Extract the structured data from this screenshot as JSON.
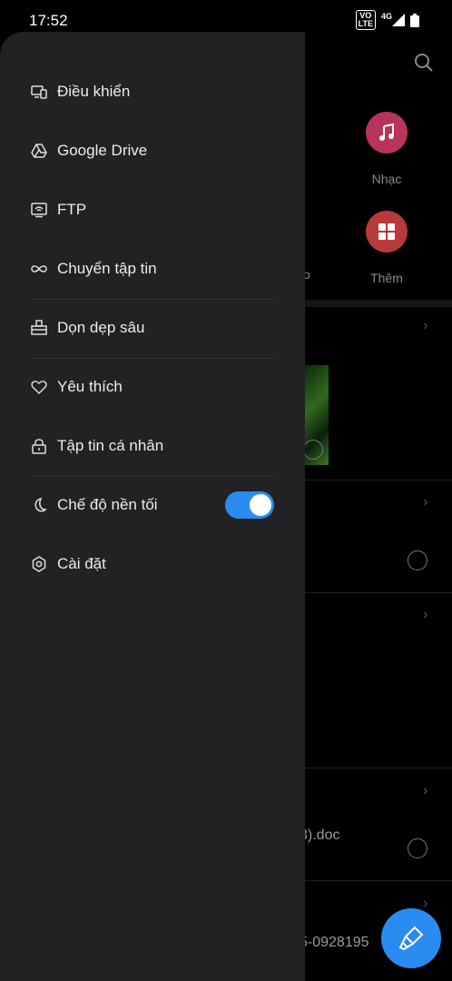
{
  "status_bar": {
    "time": "17:52",
    "volte_top": "VO",
    "volte_bottom": "LTE",
    "network": "4G"
  },
  "background": {
    "categories": [
      {
        "label": "Nhạc",
        "color": "#b8345d",
        "icon": "music-note-icon"
      },
      {
        "label": "Thêm",
        "color": "#b83a3a",
        "icon": "grid-icon"
      }
    ],
    "partial_label": "o",
    "file_name_1": "3).doc",
    "file_name_2": "5-0928195"
  },
  "drawer": {
    "items": [
      {
        "label": "Điều khiển",
        "icon": "remote-devices-icon"
      },
      {
        "label": "Google Drive",
        "icon": "google-drive-icon"
      },
      {
        "label": "FTP",
        "icon": "ftp-icon"
      },
      {
        "label": "Chuyển tập tin",
        "icon": "infinity-transfer-icon"
      },
      {
        "label": "Dọn dẹp sâu",
        "icon": "deep-clean-icon"
      },
      {
        "label": "Yêu thích",
        "icon": "heart-icon"
      },
      {
        "label": "Tập tin cá nhân",
        "icon": "lock-icon"
      },
      {
        "label": "Chế độ nền tối",
        "icon": "moon-icon",
        "toggle": true
      },
      {
        "label": "Cài đặt",
        "icon": "gear-icon"
      }
    ]
  },
  "colors": {
    "accent": "#2a8cf0",
    "drawer_bg": "#222224"
  }
}
